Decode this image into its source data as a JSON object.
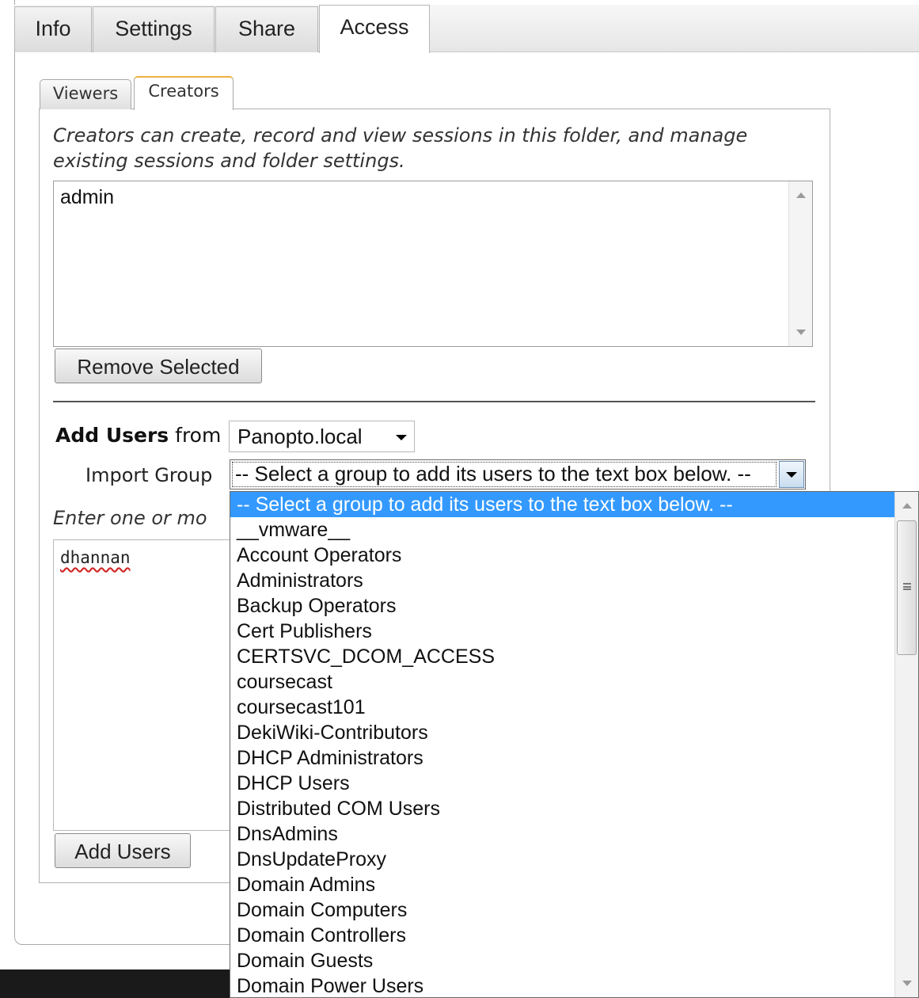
{
  "top_tabs": [
    {
      "label": "Info",
      "active": false
    },
    {
      "label": "Settings",
      "active": false
    },
    {
      "label": "Share",
      "active": false
    },
    {
      "label": "Access",
      "active": true
    }
  ],
  "sub_tabs": [
    {
      "label": "Viewers",
      "active": false
    },
    {
      "label": "Creators",
      "active": true
    }
  ],
  "creators": {
    "description": "Creators can create, record and view sessions in this folder, and manage existing sessions and folder settings.",
    "list_items": [
      "admin"
    ],
    "remove_button": "Remove Selected"
  },
  "add_users": {
    "label_bold": "Add Users",
    "label_from": "from",
    "provider_value": "Panopto.local",
    "import_group_label": "Import Group",
    "import_group_value": "-- Select a group to add its users to the text box below. --",
    "enter_label": "Enter one or mo",
    "textarea_value": "dhannan",
    "add_button": "Add Users"
  },
  "group_dropdown": {
    "options": [
      "-- Select a group to add its users to the text box below. --",
      "__vmware__",
      "Account Operators",
      "Administrators",
      "Backup Operators",
      "Cert Publishers",
      "CERTSVC_DCOM_ACCESS",
      "coursecast",
      "coursecast101",
      "DekiWiki-Contributors",
      "DHCP Administrators",
      "DHCP Users",
      "Distributed COM Users",
      "DnsAdmins",
      "DnsUpdateProxy",
      "Domain Admins",
      "Domain Computers",
      "Domain Controllers",
      "Domain Guests",
      "Domain Power Users"
    ],
    "selected_index": 0
  },
  "colors": {
    "selection": "#3399ff",
    "active_tab_accent": "#f0b040"
  }
}
